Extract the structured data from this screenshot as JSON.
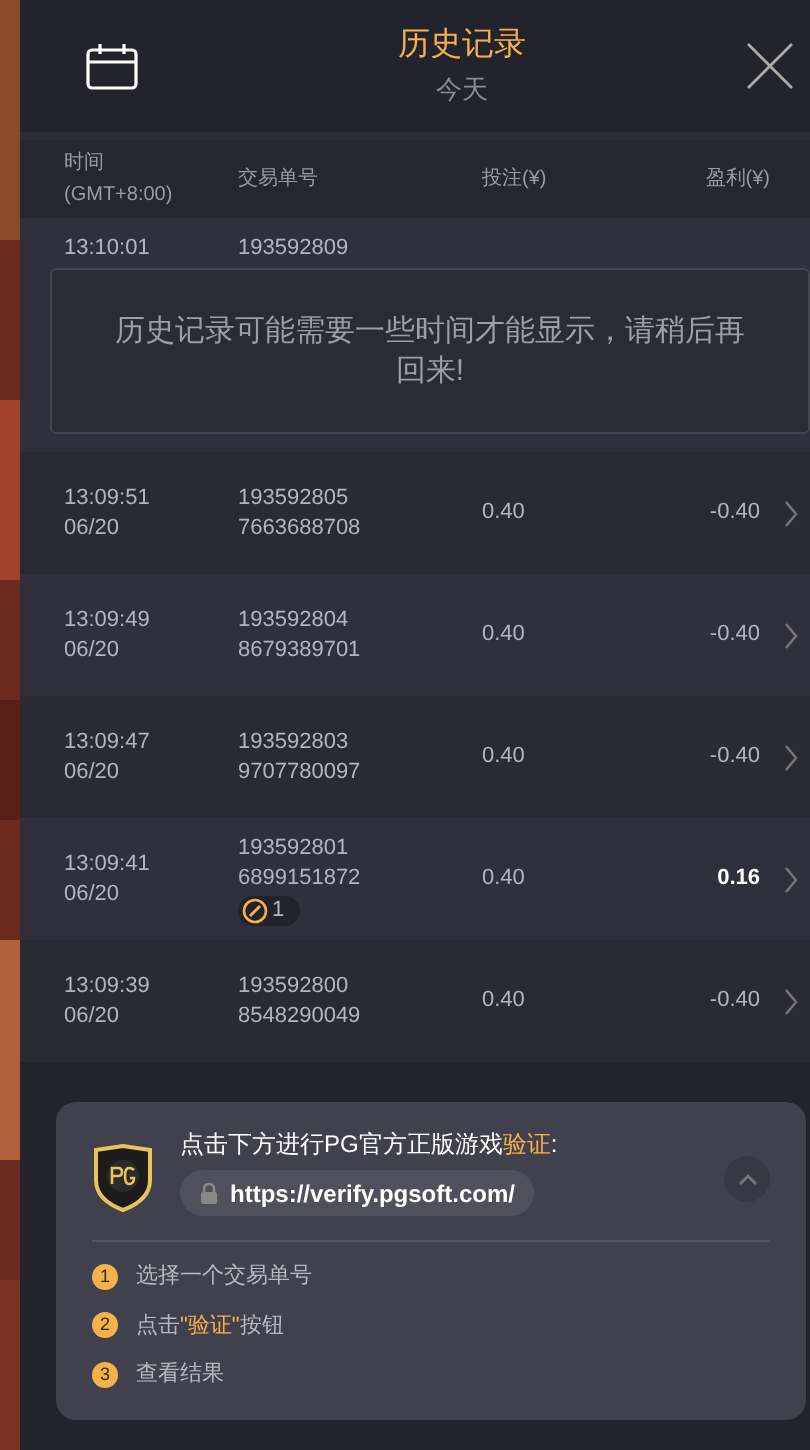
{
  "header": {
    "title": "历史记录",
    "subtitle": "今天"
  },
  "columns": [
    "时间",
    "(GMT+8:00)",
    "交易单号",
    "投注(¥)",
    "盈利(¥)"
  ],
  "notice": "历史记录可能需要一些时间才能显示，请稍后再回来!",
  "rows": [
    {
      "time": "13:10:01",
      "id": "193592809"
    },
    {
      "time": "13:09:51",
      "date": "06/20",
      "id": "193592805",
      "id2": "7663688708",
      "bet": "0.40",
      "profit": "-0.40",
      "win": false
    },
    {
      "time": "13:09:49",
      "date": "06/20",
      "id": "193592804",
      "id2": "8679389701",
      "bet": "0.40",
      "profit": "-0.40",
      "win": false
    },
    {
      "time": "13:09:47",
      "date": "06/20",
      "id": "193592803",
      "id2": "9707780097",
      "bet": "0.40",
      "profit": "-0.40",
      "win": false
    },
    {
      "time": "13:09:41",
      "date": "06/20",
      "id": "193592801",
      "id2": "6899151872",
      "badge": "1",
      "bet": "0.40",
      "profit": "0.16",
      "win": true
    },
    {
      "time": "13:09:39",
      "date": "06/20",
      "id": "193592800",
      "id2": "8548290049",
      "bet": "0.40",
      "profit": "-0.40",
      "win": false
    }
  ],
  "verify": {
    "title": [
      {
        "text": "点击下方进行PG官方正版游戏",
        "highlight": false
      },
      {
        "text": "验证",
        "highlight": true
      },
      {
        "text": ":",
        "highlight": false
      }
    ],
    "url": "https://verify.pgsoft.com/",
    "expanded": true,
    "steps": [
      {
        "number": "1",
        "parts": [
          {
            "text": "选择一个交易单号",
            "highlight": false
          }
        ]
      },
      {
        "number": "2",
        "parts": [
          {
            "text": "点击",
            "highlight": false
          },
          {
            "text": "\"验证\"",
            "highlight": true
          },
          {
            "text": "按钮",
            "highlight": false
          }
        ]
      },
      {
        "number": "3",
        "parts": [
          {
            "text": "查看结果",
            "highlight": false
          }
        ]
      }
    ]
  }
}
